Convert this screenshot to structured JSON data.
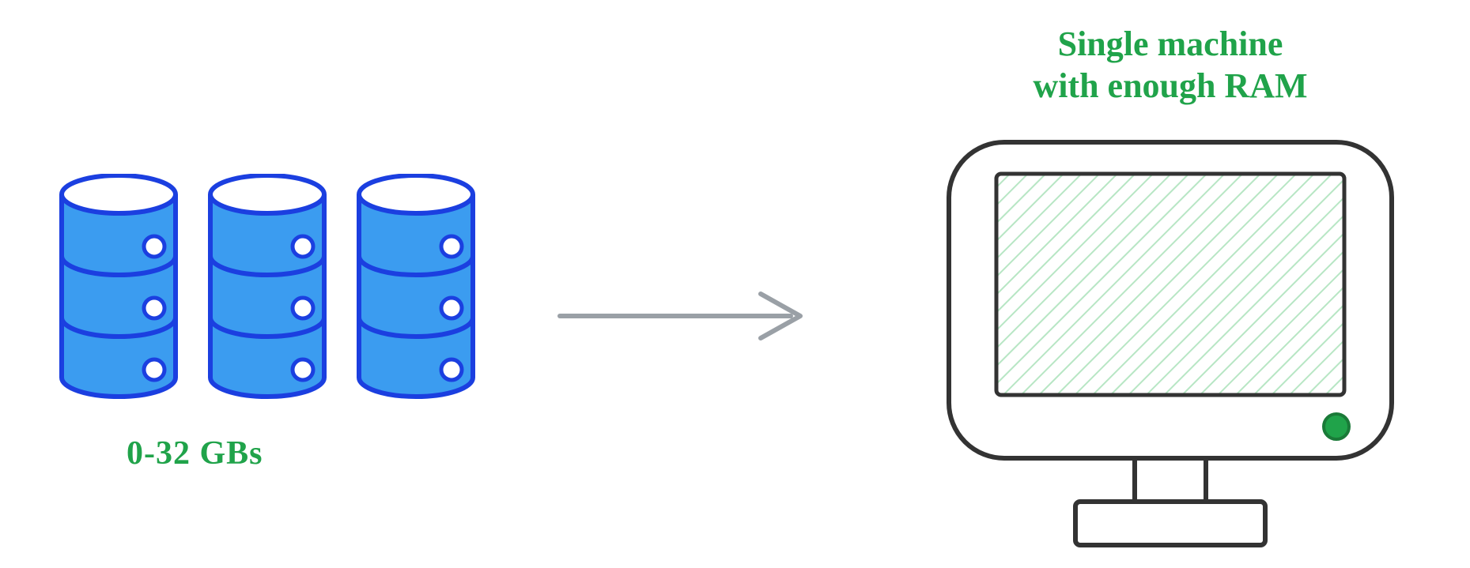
{
  "diagram": {
    "data_size_label": "0-32 GBs",
    "target_label_line1": "Single machine",
    "target_label_line2": "with enough RAM",
    "colors": {
      "accent_green": "#20a34a",
      "db_blue_fill": "#3b9cf0",
      "db_blue_stroke": "#1b3fe0",
      "arrow_gray": "#9aa0a6",
      "machine_stroke": "#333333",
      "screen_tint": "#b7e6c4"
    },
    "db_count": 3,
    "concept": "Small-to-medium data (0–32 GB) can be processed on a single machine with enough RAM"
  }
}
